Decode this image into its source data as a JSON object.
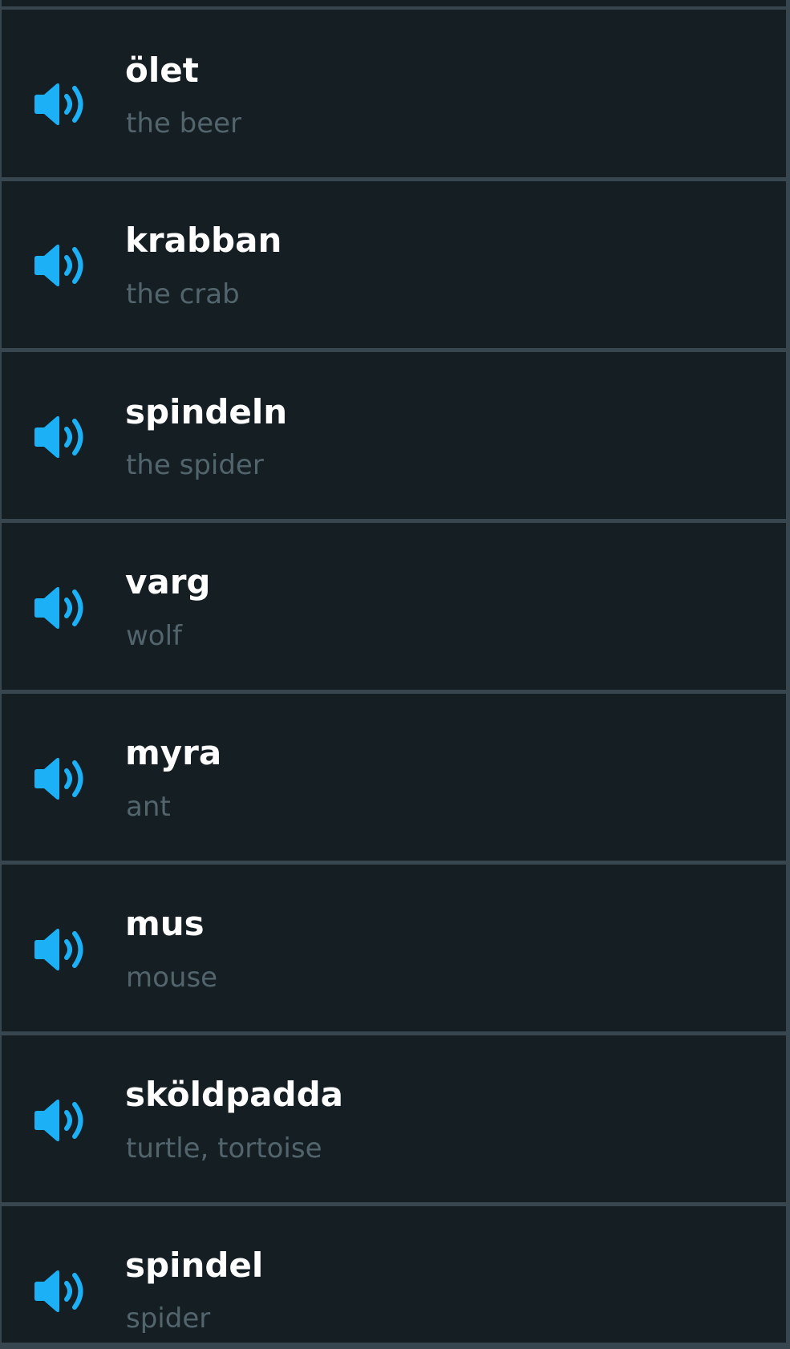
{
  "vocab_list": {
    "items": [
      {
        "word": "ölet",
        "meaning": "the beer",
        "icon": "speaker-icon"
      },
      {
        "word": "krabban",
        "meaning": "the crab",
        "icon": "speaker-icon"
      },
      {
        "word": "spindeln",
        "meaning": "the spider",
        "icon": "speaker-icon"
      },
      {
        "word": "varg",
        "meaning": "wolf",
        "icon": "speaker-icon"
      },
      {
        "word": "myra",
        "meaning": "ant",
        "icon": "speaker-icon"
      },
      {
        "word": "mus",
        "meaning": "mouse",
        "icon": "speaker-icon"
      },
      {
        "word": "sköldpadda",
        "meaning": "turtle, tortoise",
        "icon": "speaker-icon"
      },
      {
        "word": "spindel",
        "meaning": "spider",
        "icon": "speaker-icon"
      }
    ]
  },
  "colors": {
    "background": "#131f24",
    "row_background": "#151e23",
    "divider": "#37464f",
    "word": "#ffffff",
    "meaning": "#52656d",
    "speaker": "#1cb0f6"
  }
}
